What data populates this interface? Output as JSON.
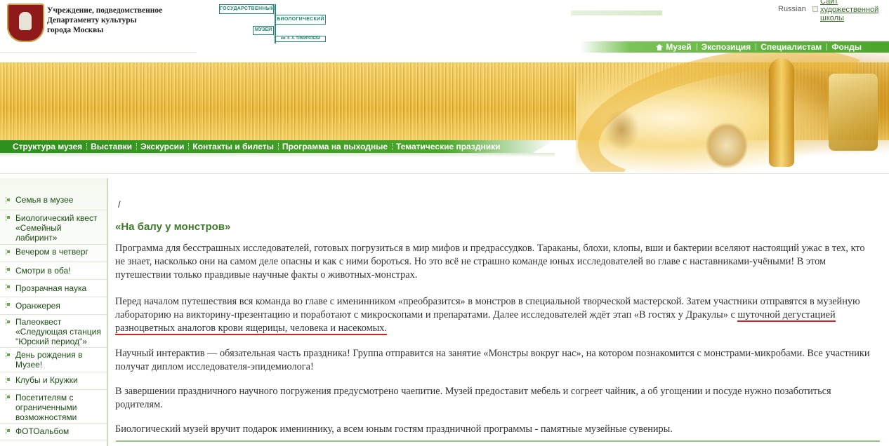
{
  "header": {
    "department_line1": "Учреждение, подведомственное",
    "department_line2": "Департаменту культуры",
    "department_line3": "города Москвы",
    "logo": {
      "line1": "ГОСУДАРСТВЕННЫЙ",
      "line2": "БИОЛОГИЧЕСКИЙ",
      "line3": "МУЗЕЙ",
      "line4": "им. К. А. ТИМИРЯЗЕВА"
    },
    "language": "Russian",
    "art_school_link": "Сайт художественной школы"
  },
  "top_nav": [
    "Музей",
    "Экспозиция",
    "Специалистам",
    "Фонды"
  ],
  "main_nav": [
    "Структура музея",
    "Выставки",
    "Экскурсии",
    "Контакты и билеты",
    "Программа на выходные",
    "Тематические праздники"
  ],
  "sidebar": {
    "items": [
      "Семья в музее",
      "Биологический квест «Семейный лабиринт»",
      "Вечером в четверг",
      "Смотри в оба!",
      "Прозрачная наука",
      "Оранжерея",
      "Палеоквест «Следующая станция \"Юрский период\"»",
      "День рождения в Музее!",
      "Клубы и Кружки",
      "Посетителям с ограниченными возможностями",
      "ФОТОальбом"
    ]
  },
  "content": {
    "breadcrumb": "/",
    "title": "«На балу у монстров»",
    "paragraphs": {
      "p1": "Программа для бесстрашных исследователей, готовых погрузиться в мир мифов и предрассудков. Тараканы, блохи, клопы, вши и бактерии вселяют настоящий ужас в тех, кто не знает, насколько они на самом деле опасны и как с ними бороться. Но это всё не страшно команде юных исследователей во главе с наставниками-учёными! В этом путешествии только правдивые научные факты о животных-монстрах.",
      "p2_start": "Перед началом путешествия вся команда во главе с именинником «преобразится» в монстров в специальной творческой мастерской. Затем участники отправятся в музейную лабораторию на викторину-презентацию и поработают с микроскопами и препаратами. Далее исследователей ждёт этап «В гостях у Дракулы» с ",
      "p2_underlined": "шуточной дегустацией разноцветных аналогов крови ящерицы, человека и насекомых.",
      "p3": "Научный интерактив — обязательная часть праздника! Группа отправится на занятие «Монстры вокруг нас», на котором познакомится с монстрами-микробами. Все участники получат диплом исследователя-эпидемиолога!",
      "p4": "В завершении праздничного научного погружения предусмотрено чаепитие. Музей предоставит мебель и согреет чайник, а об угощении и посуде нужно позаботиться родителям.",
      "p5": "Биологический музей вручит подарок имениннику, а всем юным гостям праздничной программы - памятные музейные сувениры."
    }
  }
}
